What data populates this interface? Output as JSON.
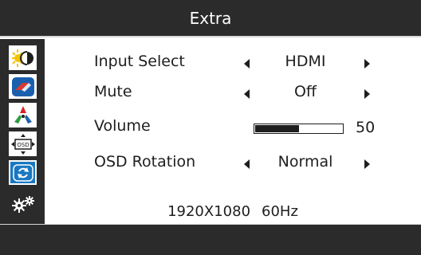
{
  "header": {
    "title": "Extra"
  },
  "sidebar": {
    "items": [
      {
        "icon": "brightness-contrast-icon"
      },
      {
        "icon": "image-color-icon"
      },
      {
        "icon": "color-rgb-icon"
      },
      {
        "icon": "osd-settings-icon"
      },
      {
        "icon": "reset-icon",
        "selected": true
      },
      {
        "icon": "extra-gears-icon"
      }
    ]
  },
  "menu": {
    "input_select": {
      "label": "Input Select",
      "value": "HDMI"
    },
    "mute": {
      "label": "Mute",
      "value": "Off"
    },
    "volume": {
      "label": "Volume",
      "value": "50",
      "level": 0.5
    },
    "osd_rotation": {
      "label": "OSD Rotation",
      "value": "Normal"
    }
  },
  "status": {
    "resolution": "1920X1080",
    "refresh": "60Hz"
  },
  "colors": {
    "bar": "#2b2b2b",
    "selected": "#1a78c2",
    "text": "#1e1e1e"
  }
}
